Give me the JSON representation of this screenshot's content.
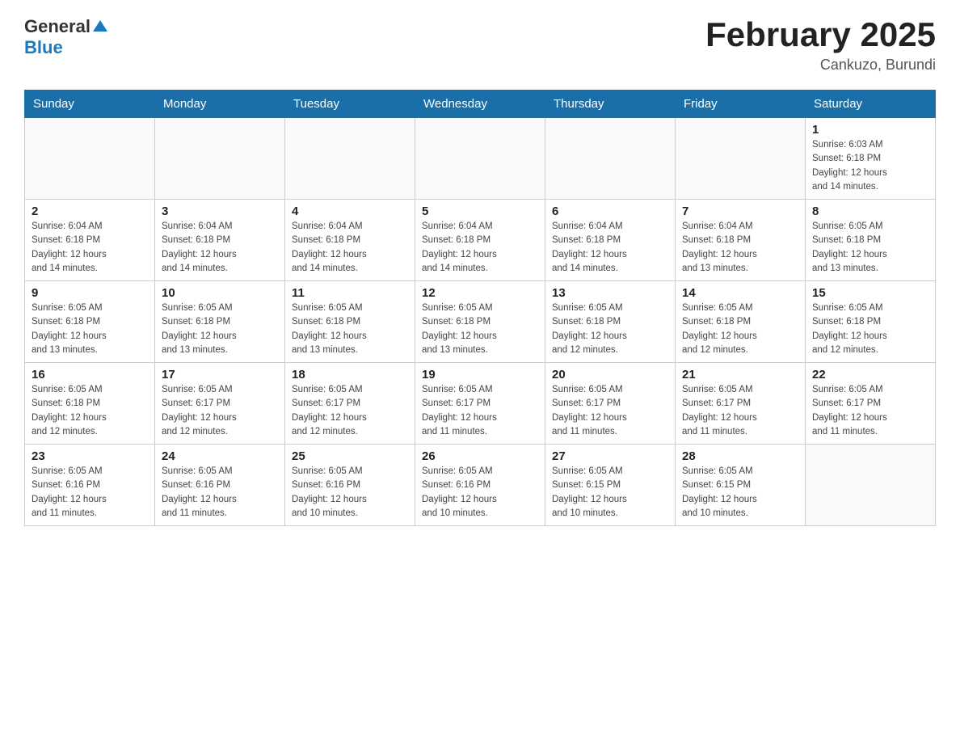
{
  "header": {
    "logo": {
      "general": "General",
      "arrow": "▲",
      "blue": "Blue"
    },
    "title": "February 2025",
    "location": "Cankuzo, Burundi"
  },
  "days_of_week": [
    "Sunday",
    "Monday",
    "Tuesday",
    "Wednesday",
    "Thursday",
    "Friday",
    "Saturday"
  ],
  "weeks": [
    [
      {
        "day": "",
        "info": ""
      },
      {
        "day": "",
        "info": ""
      },
      {
        "day": "",
        "info": ""
      },
      {
        "day": "",
        "info": ""
      },
      {
        "day": "",
        "info": ""
      },
      {
        "day": "",
        "info": ""
      },
      {
        "day": "1",
        "info": "Sunrise: 6:03 AM\nSunset: 6:18 PM\nDaylight: 12 hours\nand 14 minutes."
      }
    ],
    [
      {
        "day": "2",
        "info": "Sunrise: 6:04 AM\nSunset: 6:18 PM\nDaylight: 12 hours\nand 14 minutes."
      },
      {
        "day": "3",
        "info": "Sunrise: 6:04 AM\nSunset: 6:18 PM\nDaylight: 12 hours\nand 14 minutes."
      },
      {
        "day": "4",
        "info": "Sunrise: 6:04 AM\nSunset: 6:18 PM\nDaylight: 12 hours\nand 14 minutes."
      },
      {
        "day": "5",
        "info": "Sunrise: 6:04 AM\nSunset: 6:18 PM\nDaylight: 12 hours\nand 14 minutes."
      },
      {
        "day": "6",
        "info": "Sunrise: 6:04 AM\nSunset: 6:18 PM\nDaylight: 12 hours\nand 14 minutes."
      },
      {
        "day": "7",
        "info": "Sunrise: 6:04 AM\nSunset: 6:18 PM\nDaylight: 12 hours\nand 13 minutes."
      },
      {
        "day": "8",
        "info": "Sunrise: 6:05 AM\nSunset: 6:18 PM\nDaylight: 12 hours\nand 13 minutes."
      }
    ],
    [
      {
        "day": "9",
        "info": "Sunrise: 6:05 AM\nSunset: 6:18 PM\nDaylight: 12 hours\nand 13 minutes."
      },
      {
        "day": "10",
        "info": "Sunrise: 6:05 AM\nSunset: 6:18 PM\nDaylight: 12 hours\nand 13 minutes."
      },
      {
        "day": "11",
        "info": "Sunrise: 6:05 AM\nSunset: 6:18 PM\nDaylight: 12 hours\nand 13 minutes."
      },
      {
        "day": "12",
        "info": "Sunrise: 6:05 AM\nSunset: 6:18 PM\nDaylight: 12 hours\nand 13 minutes."
      },
      {
        "day": "13",
        "info": "Sunrise: 6:05 AM\nSunset: 6:18 PM\nDaylight: 12 hours\nand 12 minutes."
      },
      {
        "day": "14",
        "info": "Sunrise: 6:05 AM\nSunset: 6:18 PM\nDaylight: 12 hours\nand 12 minutes."
      },
      {
        "day": "15",
        "info": "Sunrise: 6:05 AM\nSunset: 6:18 PM\nDaylight: 12 hours\nand 12 minutes."
      }
    ],
    [
      {
        "day": "16",
        "info": "Sunrise: 6:05 AM\nSunset: 6:18 PM\nDaylight: 12 hours\nand 12 minutes."
      },
      {
        "day": "17",
        "info": "Sunrise: 6:05 AM\nSunset: 6:17 PM\nDaylight: 12 hours\nand 12 minutes."
      },
      {
        "day": "18",
        "info": "Sunrise: 6:05 AM\nSunset: 6:17 PM\nDaylight: 12 hours\nand 12 minutes."
      },
      {
        "day": "19",
        "info": "Sunrise: 6:05 AM\nSunset: 6:17 PM\nDaylight: 12 hours\nand 11 minutes."
      },
      {
        "day": "20",
        "info": "Sunrise: 6:05 AM\nSunset: 6:17 PM\nDaylight: 12 hours\nand 11 minutes."
      },
      {
        "day": "21",
        "info": "Sunrise: 6:05 AM\nSunset: 6:17 PM\nDaylight: 12 hours\nand 11 minutes."
      },
      {
        "day": "22",
        "info": "Sunrise: 6:05 AM\nSunset: 6:17 PM\nDaylight: 12 hours\nand 11 minutes."
      }
    ],
    [
      {
        "day": "23",
        "info": "Sunrise: 6:05 AM\nSunset: 6:16 PM\nDaylight: 12 hours\nand 11 minutes."
      },
      {
        "day": "24",
        "info": "Sunrise: 6:05 AM\nSunset: 6:16 PM\nDaylight: 12 hours\nand 11 minutes."
      },
      {
        "day": "25",
        "info": "Sunrise: 6:05 AM\nSunset: 6:16 PM\nDaylight: 12 hours\nand 10 minutes."
      },
      {
        "day": "26",
        "info": "Sunrise: 6:05 AM\nSunset: 6:16 PM\nDaylight: 12 hours\nand 10 minutes."
      },
      {
        "day": "27",
        "info": "Sunrise: 6:05 AM\nSunset: 6:15 PM\nDaylight: 12 hours\nand 10 minutes."
      },
      {
        "day": "28",
        "info": "Sunrise: 6:05 AM\nSunset: 6:15 PM\nDaylight: 12 hours\nand 10 minutes."
      },
      {
        "day": "",
        "info": ""
      }
    ]
  ]
}
